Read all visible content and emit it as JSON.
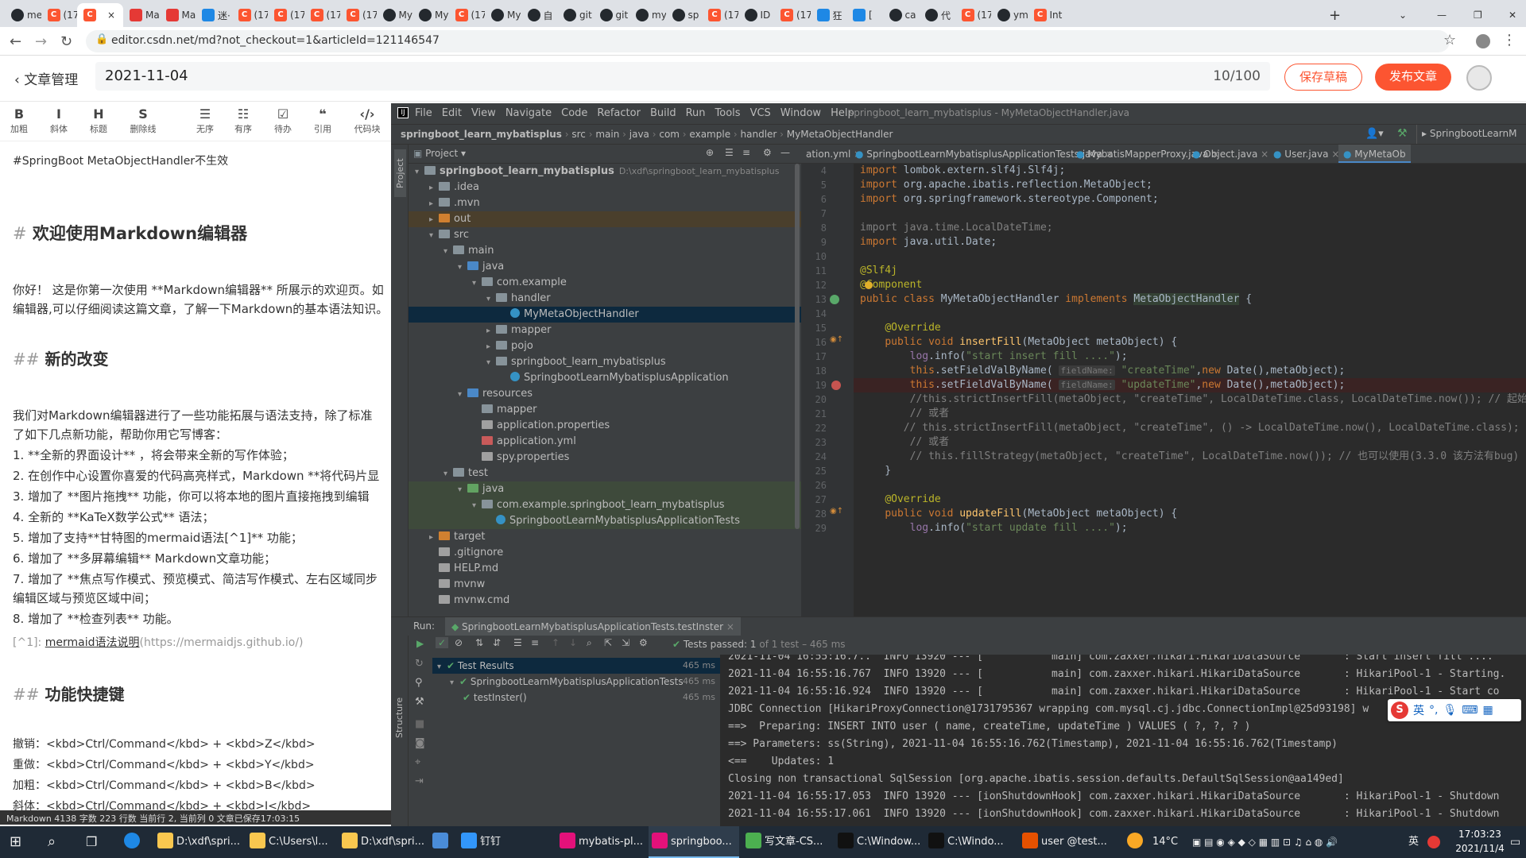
{
  "browser": {
    "tabs": [
      {
        "label": "me",
        "icon": "github-icon"
      },
      {
        "label": "(17",
        "icon": "csdn-icon"
      },
      {
        "label": "",
        "icon": "csdn-icon"
      },
      {
        "label": "Ma",
        "icon": "markdown-icon"
      },
      {
        "label": "Ma",
        "icon": "markdown-icon"
      },
      {
        "label": "迷·",
        "icon": "browser-icon"
      },
      {
        "label": "(17",
        "icon": "csdn-icon"
      },
      {
        "label": "(17",
        "icon": "csdn-icon"
      },
      {
        "label": "(17",
        "icon": "csdn-icon"
      },
      {
        "label": "(17",
        "icon": "csdn-icon"
      },
      {
        "label": "My",
        "icon": "github-icon"
      },
      {
        "label": "My",
        "icon": "github-icon"
      },
      {
        "label": "(17",
        "icon": "csdn-icon"
      },
      {
        "label": "My",
        "icon": "github-icon"
      },
      {
        "label": "自",
        "icon": "github-icon"
      },
      {
        "label": "git",
        "icon": "github-icon"
      },
      {
        "label": "git",
        "icon": "github-icon"
      },
      {
        "label": "my",
        "icon": "github-icon"
      },
      {
        "label": "sp",
        "icon": "github-icon"
      },
      {
        "label": "(17",
        "icon": "csdn-icon"
      },
      {
        "label": "ID",
        "icon": "github-icon"
      },
      {
        "label": "(17",
        "icon": "csdn-icon"
      },
      {
        "label": "狂",
        "icon": "browser-icon"
      },
      {
        "label": "[",
        "icon": "browser-icon"
      },
      {
        "label": "ca",
        "icon": "github-icon"
      },
      {
        "label": "代",
        "icon": "github-icon"
      },
      {
        "label": "(17",
        "icon": "csdn-icon"
      },
      {
        "label": "ym",
        "icon": "github-icon"
      },
      {
        "label": "Int",
        "icon": "csdn-icon"
      }
    ],
    "new_tab": "+",
    "url": "editor.csdn.net/md?not_checkout=1&articleId=121146547"
  },
  "csdn": {
    "back_label": "文章管理",
    "title_value": "2021-11-04",
    "title_count": "10/100",
    "save_draft": "保存草稿",
    "publish": "发布文章"
  },
  "md_toolbar": [
    {
      "icon": "B",
      "label": "加粗"
    },
    {
      "icon": "I",
      "label": "斜体"
    },
    {
      "icon": "H",
      "label": "标题"
    },
    {
      "icon": "S",
      "label": "删除线"
    },
    {
      "icon": "☰",
      "label": "无序"
    },
    {
      "icon": "☷",
      "label": "有序"
    },
    {
      "icon": "☑",
      "label": "待办"
    },
    {
      "icon": "❝",
      "label": "引用"
    },
    {
      "icon": "‹/›",
      "label": "代码块"
    }
  ],
  "md_content": {
    "tagline": "#SpringBoot MetaObjectHandler不生效",
    "h1_mark": "#",
    "h1_text": "欢迎使用Markdown编辑器",
    "p1": "你好！ 这是你第一次使用 **Markdown编辑器** 所展示的欢迎页。如",
    "p1b": "编辑器,可以仔细阅读这篇文章，了解一下Markdown的基本语法知识。",
    "h2a_mark": "##",
    "h2a_text": "新的改变",
    "p2": "我们对Markdown编辑器进行了一些功能拓展与语法支持，除了标准",
    "p2b": "了如下几点新功能，帮助你用它写博客：",
    "list": [
      "1. **全新的界面设计** ，将会带来全新的写作体验；",
      "2. 在创作中心设置你喜爱的代码高亮样式，Markdown **将代码片显",
      "3. 增加了 **图片拖拽** 功能，你可以将本地的图片直接拖拽到编辑",
      "4. 全新的 **KaTeX数学公式** 语法；",
      "5. 增加了支持**甘特图的mermaid语法[^1]** 功能；",
      "6. 增加了 **多屏幕编辑** Markdown文章功能；",
      "7. 增加了 **焦点写作模式、预览模式、简洁写作模式、左右区域同步",
      "   编辑区域与预览区域中间；",
      "8. 增加了 **检查列表** 功能。"
    ],
    "footnote_ref": "[^1]: ",
    "footnote_link": "mermaid语法说明",
    "footnote_url": "(https://mermaidjs.github.io/)",
    "h2b_mark": "##",
    "h2b_text": "功能快捷键",
    "shortcuts": [
      "撤销：<kbd>Ctrl/Command</kbd> + <kbd>Z</kbd>",
      "重做：<kbd>Ctrl/Command</kbd> + <kbd>Y</kbd>",
      "加粗：<kbd>Ctrl/Command</kbd> + <kbd>B</kbd>",
      "斜体：<kbd>Ctrl/Command</kbd> + <kbd>I</kbd>"
    ],
    "status": "Markdown  4138 字数  223 行数  当前行 2, 当前列 0  文章已保存17:03:15"
  },
  "ide": {
    "menu": [
      "File",
      "Edit",
      "View",
      "Navigate",
      "Code",
      "Refactor",
      "Build",
      "Run",
      "Tools",
      "VCS",
      "Window",
      "Help"
    ],
    "window_title": "springboot_learn_mybatisplus - MyMetaObjectHandler.java",
    "breadcrumb": [
      "springboot_learn_mybatisplus",
      "src",
      "main",
      "java",
      "com",
      "example",
      "handler",
      "MyMetaObjectHandler"
    ],
    "run_config": "SpringbootLearnM",
    "project_label": "Project",
    "side_label_project": "Project",
    "side_label_structure": "Structure",
    "tree": [
      {
        "depth": 0,
        "arrow": "▾",
        "icon": "module",
        "label": "springboot_learn_mybatisplus",
        "extra": "D:\\xdf\\springboot_learn_mybatisplus",
        "bold": true
      },
      {
        "depth": 1,
        "arrow": "▸",
        "icon": "folder",
        "label": ".idea"
      },
      {
        "depth": 1,
        "arrow": "▸",
        "icon": "folder",
        "label": ".mvn"
      },
      {
        "depth": 1,
        "arrow": "▸",
        "icon": "folder-orange",
        "label": "out",
        "hl": "out"
      },
      {
        "depth": 1,
        "arrow": "▾",
        "icon": "folder",
        "label": "src"
      },
      {
        "depth": 2,
        "arrow": "▾",
        "icon": "folder",
        "label": "main"
      },
      {
        "depth": 3,
        "arrow": "▾",
        "icon": "folder-blue",
        "label": "java"
      },
      {
        "depth": 4,
        "arrow": "▾",
        "icon": "package",
        "label": "com.example"
      },
      {
        "depth": 5,
        "arrow": "▾",
        "icon": "package",
        "label": "handler"
      },
      {
        "depth": 6,
        "arrow": "",
        "icon": "class",
        "label": "MyMetaObjectHandler",
        "hl": "sel"
      },
      {
        "depth": 5,
        "arrow": "▸",
        "icon": "package",
        "label": "mapper"
      },
      {
        "depth": 5,
        "arrow": "▸",
        "icon": "package",
        "label": "pojo"
      },
      {
        "depth": 5,
        "arrow": "▾",
        "icon": "package",
        "label": "springboot_learn_mybatisplus"
      },
      {
        "depth": 6,
        "arrow": "",
        "icon": "class",
        "label": "SpringbootLearnMybatisplusApplication"
      },
      {
        "depth": 3,
        "arrow": "▾",
        "icon": "folder-res",
        "label": "resources"
      },
      {
        "depth": 4,
        "arrow": "",
        "icon": "folder",
        "label": "mapper"
      },
      {
        "depth": 4,
        "arrow": "",
        "icon": "props",
        "label": "application.properties"
      },
      {
        "depth": 4,
        "arrow": "",
        "icon": "yml",
        "label": "application.yml"
      },
      {
        "depth": 4,
        "arrow": "",
        "icon": "props",
        "label": "spy.properties"
      },
      {
        "depth": 2,
        "arrow": "▾",
        "icon": "folder",
        "label": "test"
      },
      {
        "depth": 3,
        "arrow": "▾",
        "icon": "folder-green",
        "label": "java",
        "hl": "test"
      },
      {
        "depth": 4,
        "arrow": "▾",
        "icon": "package",
        "label": "com.example.springboot_learn_mybatisplus",
        "hl": "test"
      },
      {
        "depth": 5,
        "arrow": "",
        "icon": "class",
        "label": "SpringbootLearnMybatisplusApplicationTests",
        "hl": "test"
      },
      {
        "depth": 1,
        "arrow": "▸",
        "icon": "folder-orange",
        "label": "target"
      },
      {
        "depth": 1,
        "arrow": "",
        "icon": "file",
        "label": ".gitignore"
      },
      {
        "depth": 1,
        "arrow": "",
        "icon": "file",
        "label": "HELP.md"
      },
      {
        "depth": 1,
        "arrow": "",
        "icon": "file",
        "label": "mvnw"
      },
      {
        "depth": 1,
        "arrow": "",
        "icon": "file",
        "label": "mvnw.cmd"
      }
    ],
    "editor_tabs": [
      "ation.yml",
      "SpringbootLearnMybatisplusApplicationTests.java",
      "MybatisMapperProxy.java",
      "Object.java",
      "User.java",
      "MyMetaOb"
    ],
    "code_lines": [
      {
        "n": "4",
        "html": "<span class='kw'>import </span>lombok.extern.slf4j.Slf4j;"
      },
      {
        "n": "5",
        "html": "<span class='kw'>import </span>org.apache.ibatis.reflection.MetaObject;"
      },
      {
        "n": "6",
        "html": "<span class='kw'>import </span>org.springframework.stereotype.<span style='color:#a9b7c6'>Component</span>;"
      },
      {
        "n": "7",
        "html": ""
      },
      {
        "n": "8",
        "html": "<span class='cm'>import java.time.LocalDateTime;</span>"
      },
      {
        "n": "9",
        "html": "<span class='kw'>import </span>java.util.Date;"
      },
      {
        "n": "10",
        "html": ""
      },
      {
        "n": "11",
        "html": "<span class='an'>@Slf4j</span>"
      },
      {
        "n": "12",
        "html": "<span class='an'>@Component</span>"
      },
      {
        "n": "13",
        "html": "<span class='kw'>public class </span>MyMetaObjectHandler <span class='kw'>implements </span><span style='background:#344134;color:#a9b7c6'>MetaObjectHandler</span> {"
      },
      {
        "n": "14",
        "html": ""
      },
      {
        "n": "15",
        "html": "    <span class='an'>@Override</span>"
      },
      {
        "n": "16",
        "html": "    <span class='kw'>public void </span><span class='fn'>insertFill</span>(MetaObject metaObject) {"
      },
      {
        "n": "17",
        "html": "        <span class='pu'>log</span>.info(<span class='st'>\"start insert fill ....\"</span>);"
      },
      {
        "n": "18",
        "html": "        <span class='kw'>this</span>.setFieldValByName( <span class='hint'>fieldName:</span> <span class='st'>\"createTime\"</span>,<span class='kw'>new </span>Date(),metaObject);"
      },
      {
        "n": "19",
        "html": "        <span class='kw'>this</span>.setFieldValByName( <span class='hint'>fieldName:</span> <span class='st'>\"updateTime\"</span>,<span class='kw'>new </span>Date(),metaObject);",
        "bp": true
      },
      {
        "n": "20",
        "html": "        <span class='cm'>//this.strictInsertFill(metaObject, \"createTime\", LocalDateTime.class, LocalDateTime.now()); // 起始</span>"
      },
      {
        "n": "21",
        "html": "        <span class='cm'>// 或者</span>"
      },
      {
        "n": "22",
        "html": "       <span class='cm'>// this.strictInsertFill(metaObject, \"createTime\", () -> LocalDateTime.now(), LocalDateTime.class); /</span>"
      },
      {
        "n": "23",
        "html": "        <span class='cm'>// 或者</span>"
      },
      {
        "n": "24",
        "html": "        <span class='cm'>// this.fillStrategy(metaObject, \"createTime\", LocalDateTime.now()); // 也可以使用(3.3.0 该方法有bug)</span>"
      },
      {
        "n": "25",
        "html": "    }"
      },
      {
        "n": "26",
        "html": ""
      },
      {
        "n": "27",
        "html": "    <span class='an'>@Override</span>"
      },
      {
        "n": "28",
        "html": "    <span class='kw'>public void </span><span class='fn'>updateFill</span>(MetaObject metaObject) {"
      },
      {
        "n": "29",
        "html": "        <span class='pu'>log</span>.info(<span class='st'>\"start update fill ....\"</span>);"
      }
    ],
    "run_label": "Run:",
    "run_tab": "SpringbootLearnMybatisplusApplicationTests.testInster",
    "tests_passed": "Tests passed: 1",
    "tests_passed_detail": "of 1 test – 465 ms",
    "test_tree": [
      {
        "depth": 0,
        "label": "Test Results",
        "time": "465 ms"
      },
      {
        "depth": 1,
        "label": "SpringbootLearnMybatisplusApplicationTests",
        "time": "465 ms"
      },
      {
        "depth": 2,
        "label": "testInster()",
        "time": "465 ms"
      }
    ],
    "console": [
      "2021-11-04 16:55:16.7..  INFO 13920 --- [           main] com.zaxxer.hikari.HikariDataSource       : Start insert fill ....",
      "2021-11-04 16:55:16.767  INFO 13920 --- [           main] com.zaxxer.hikari.HikariDataSource       : HikariPool-1 - Starting.",
      "2021-11-04 16:55:16.924  INFO 13920 --- [           main] com.zaxxer.hikari.HikariDataSource       : HikariPool-1 - Start co",
      "JDBC Connection [HikariProxyConnection@1731795367 wrapping com.mysql.cj.jdbc.ConnectionImpl@25d93198] w",
      "==>  Preparing: INSERT INTO user ( name, createTime, updateTime ) VALUES ( ?, ?, ? )",
      "==> Parameters: ss(String), 2021-11-04 16:55:16.762(Timestamp), 2021-11-04 16:55:16.762(Timestamp)",
      "<==    Updates: 1",
      "Closing non transactional SqlSession [org.apache.ibatis.session.defaults.DefaultSqlSession@aa149ed]",
      "2021-11-04 16:55:17.053  INFO 13920 --- [ionShutdownHook] com.zaxxer.hikari.HikariDataSource       : HikariPool-1 - Shutdown",
      "2021-11-04 16:55:17.061  INFO 13920 --- [ionShutdownHook] com.zaxxer.hikari.HikariDataSource       : HikariPool-1 - Shutdown"
    ]
  },
  "ime": {
    "label": "英"
  },
  "taskbar": {
    "items": [
      {
        "label": "D:\\xdf\\spri...",
        "icon": "folder-icon"
      },
      {
        "label": "C:\\Users\\l...",
        "icon": "folder-icon"
      },
      {
        "label": "D:\\xdf\\spri...",
        "icon": "folder-icon"
      },
      {
        "label": "",
        "icon": "store-icon"
      },
      {
        "label": "钉钉",
        "icon": "dingtalk-icon"
      },
      {
        "label": "mybatis-pl...",
        "icon": "intellij-icon"
      },
      {
        "label": "springboo...",
        "icon": "intellij-icon"
      },
      {
        "label": "写文章-CS...",
        "icon": "chrome-icon"
      },
      {
        "label": "C:\\Window...",
        "icon": "terminal-icon"
      },
      {
        "label": "C:\\Windo...",
        "icon": "terminal-icon"
      },
      {
        "label": "user @test...",
        "icon": "db-icon"
      }
    ],
    "weather": "14°C",
    "lang": "英",
    "time": "17:03:23",
    "date": "2021/11/4"
  }
}
